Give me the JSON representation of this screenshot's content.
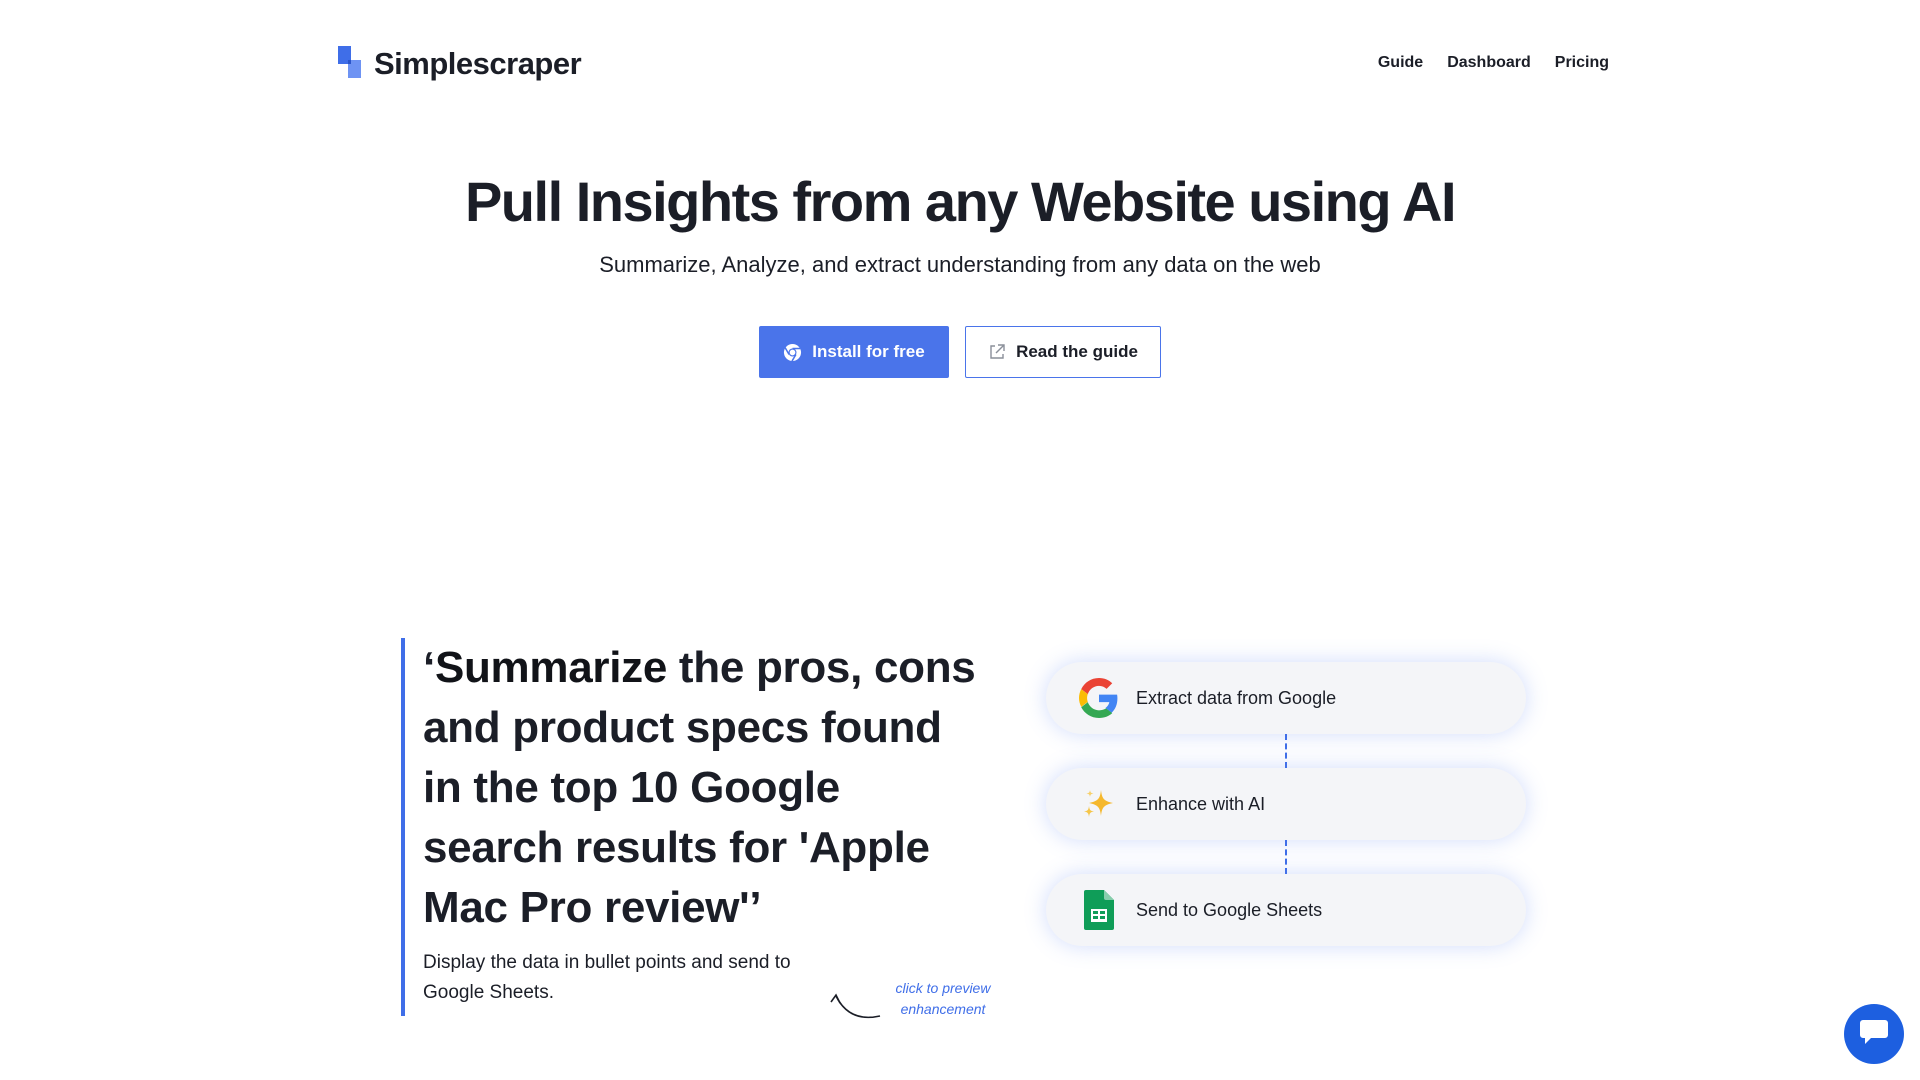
{
  "header": {
    "logo_text": "Simplescraper",
    "nav": [
      "Guide",
      "Dashboard",
      "Pricing"
    ]
  },
  "hero": {
    "title": "Pull Insights from any Website using AI",
    "subtitle": "Summarize, Analyze, and extract understanding from any data on the web",
    "primary_button": "Install for free",
    "secondary_button": "Read the guide",
    "primary_icon": "chrome-icon",
    "secondary_icon": "external-link-icon"
  },
  "showcase": {
    "quote_open": "‘",
    "quote_strong": "Summarize",
    "quote_rest": " the pros, cons and product specs found in the top 10 Google search results for 'Apple Mac Pro review'",
    "quote_close": "’",
    "body": "Display the data in bullet points and send to Google Sheets.",
    "hint": "click to preview enhancement"
  },
  "flow": {
    "steps": [
      {
        "label": "Extract data from Google",
        "icon": "google-icon"
      },
      {
        "label": "Enhance with AI",
        "icon": "sparkles-icon"
      },
      {
        "label": "Send to Google Sheets",
        "icon": "google-sheets-icon"
      }
    ]
  },
  "colors": {
    "accent": "#4a74ea",
    "chat": "#1d5fe0",
    "text": "#1b1e27"
  },
  "chat": {
    "icon": "chat-icon"
  }
}
